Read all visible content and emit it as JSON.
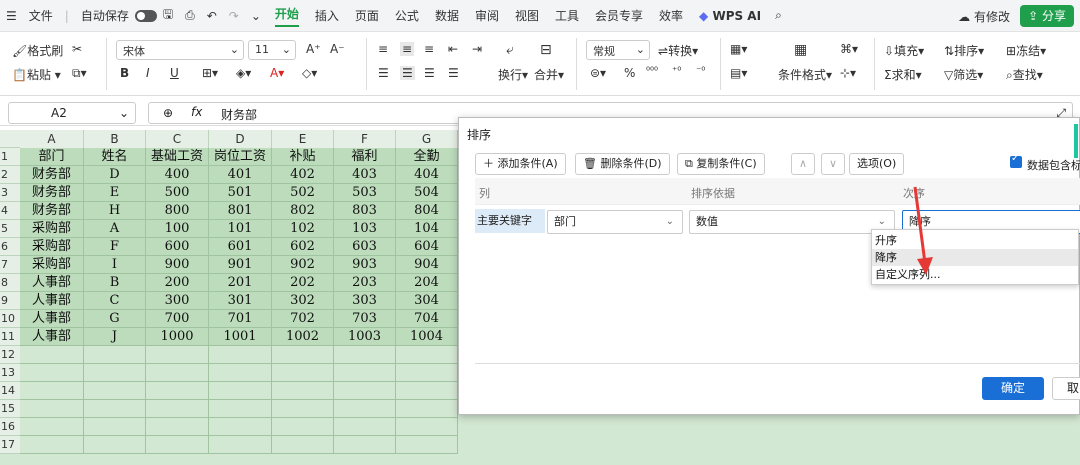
{
  "titlebar": {
    "menu_icon": "menu-icon",
    "file": "文件",
    "autosave": "自动保存",
    "tabs": [
      "开始",
      "插入",
      "页面",
      "公式",
      "数据",
      "审阅",
      "视图",
      "工具",
      "会员专享",
      "效率"
    ],
    "active_tab": "开始",
    "wps_ai": "WPS AI",
    "modify": "有修改",
    "share": "分享"
  },
  "ribbon": {
    "format_painter": "格式刷",
    "paste": "粘贴",
    "font_name": "宋体",
    "font_size": "11",
    "number_format": "常规",
    "convert": "转换",
    "wrap": "换行",
    "merge": "合并",
    "conditional_format": "条件格式",
    "fill": "填充",
    "sort": "排序",
    "freeze": "冻结",
    "sum": "求和",
    "filter": "筛选",
    "find": "查找",
    "bold": "B",
    "italic": "I",
    "underline": "U",
    "percent": "%"
  },
  "formula_bar": {
    "cell_ref": "A2",
    "fx": "fx",
    "value": "财务部"
  },
  "sheet": {
    "columns": [
      "A",
      "B",
      "C",
      "D",
      "E",
      "F",
      "G"
    ],
    "rows": [
      "1",
      "2",
      "3",
      "4",
      "5",
      "6",
      "7",
      "8",
      "9",
      "10",
      "11",
      "12",
      "13",
      "14",
      "15",
      "16",
      "17"
    ],
    "data": [
      [
        "部门",
        "姓名",
        "基础工资",
        "岗位工资",
        "补贴",
        "福利",
        "全勤"
      ],
      [
        "财务部",
        "D",
        "400",
        "401",
        "402",
        "403",
        "404"
      ],
      [
        "财务部",
        "E",
        "500",
        "501",
        "502",
        "503",
        "504"
      ],
      [
        "财务部",
        "H",
        "800",
        "801",
        "802",
        "803",
        "804"
      ],
      [
        "采购部",
        "A",
        "100",
        "101",
        "102",
        "103",
        "104"
      ],
      [
        "采购部",
        "F",
        "600",
        "601",
        "602",
        "603",
        "604"
      ],
      [
        "采购部",
        "I",
        "900",
        "901",
        "902",
        "903",
        "904"
      ],
      [
        "人事部",
        "B",
        "200",
        "201",
        "202",
        "203",
        "204"
      ],
      [
        "人事部",
        "C",
        "300",
        "301",
        "302",
        "303",
        "304"
      ],
      [
        "人事部",
        "G",
        "700",
        "701",
        "702",
        "703",
        "704"
      ],
      [
        "人事部",
        "J",
        "1000",
        "1001",
        "1002",
        "1003",
        "1004"
      ]
    ]
  },
  "sort_dialog": {
    "title": "排序",
    "add_condition": "添加条件(A)",
    "delete_condition": "删除条件(D)",
    "copy_condition": "复制条件(C)",
    "options": "选项(O)",
    "has_header": "数据包含标",
    "headers": {
      "column": "列",
      "sort_on": "排序依据",
      "order": "次序"
    },
    "key_label": "主要关键字",
    "key_value": "部门",
    "sort_on_value": "数值",
    "order_value": "降序",
    "order_options": [
      "升序",
      "降序",
      "自定义序列..."
    ],
    "ok": "确定",
    "cancel": "取"
  }
}
